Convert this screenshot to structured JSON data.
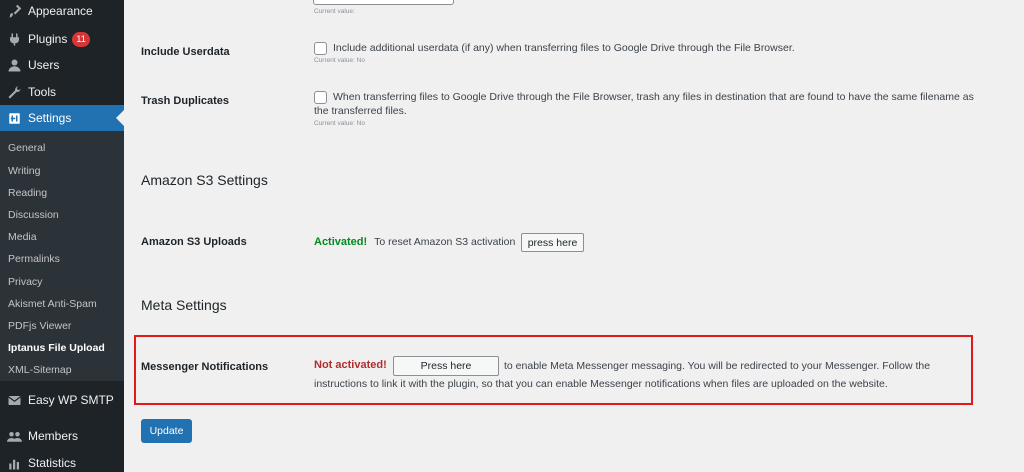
{
  "sidebar": {
    "menu": [
      {
        "label": "Appearance",
        "icon": "paintbrush-icon"
      },
      {
        "label": "Plugins",
        "icon": "plug-icon",
        "badge": "11"
      },
      {
        "label": "Users",
        "icon": "user-icon"
      },
      {
        "label": "Tools",
        "icon": "wrench-icon"
      },
      {
        "label": "Settings",
        "icon": "settings-icon"
      }
    ],
    "submenu": [
      "General",
      "Writing",
      "Reading",
      "Discussion",
      "Media",
      "Permalinks",
      "Privacy",
      "Akismet Anti-Spam",
      "PDFjs Viewer",
      "Iptanus File Upload",
      "XML-Sitemap"
    ],
    "bottom_menu": [
      {
        "label": "Easy WP SMTP",
        "icon": "email-icon"
      },
      {
        "label": "Members",
        "icon": "group-icon"
      },
      {
        "label": "Statistics",
        "icon": "chart-icon"
      }
    ],
    "active_color": "#2271b1"
  },
  "settings": {
    "current_value_label": "Current value:",
    "include_userdata": {
      "label": "Include Userdata",
      "description": "Include additional userdata (if any) when transferring files to Google Drive through the File Browser.",
      "current": "Current value: No"
    },
    "trash_duplicates": {
      "label": "Trash Duplicates",
      "description_line1": "When transferring files to Google Drive through the File Browser, trash any files in destination that are found to have the same filename as",
      "description_line2": "the transferred files.",
      "current": "Current value: No"
    },
    "amazon": {
      "section_title": "Amazon S3 Settings",
      "label": "Amazon S3 Uploads",
      "status": "Activated!",
      "text": "To reset Amazon S3 activation",
      "button": "press here"
    },
    "meta": {
      "section_title": "Meta Settings",
      "label": "Messenger Notifications",
      "status": "Not activated!",
      "button": "Press here",
      "text_line1": "to enable Meta Messenger messaging. You will be redirected to your Messenger. Follow the",
      "text_line2": "instructions to link it with the plugin, so that you can enable Messenger notifications when files are uploaded on the website."
    },
    "update_button": "Update"
  }
}
